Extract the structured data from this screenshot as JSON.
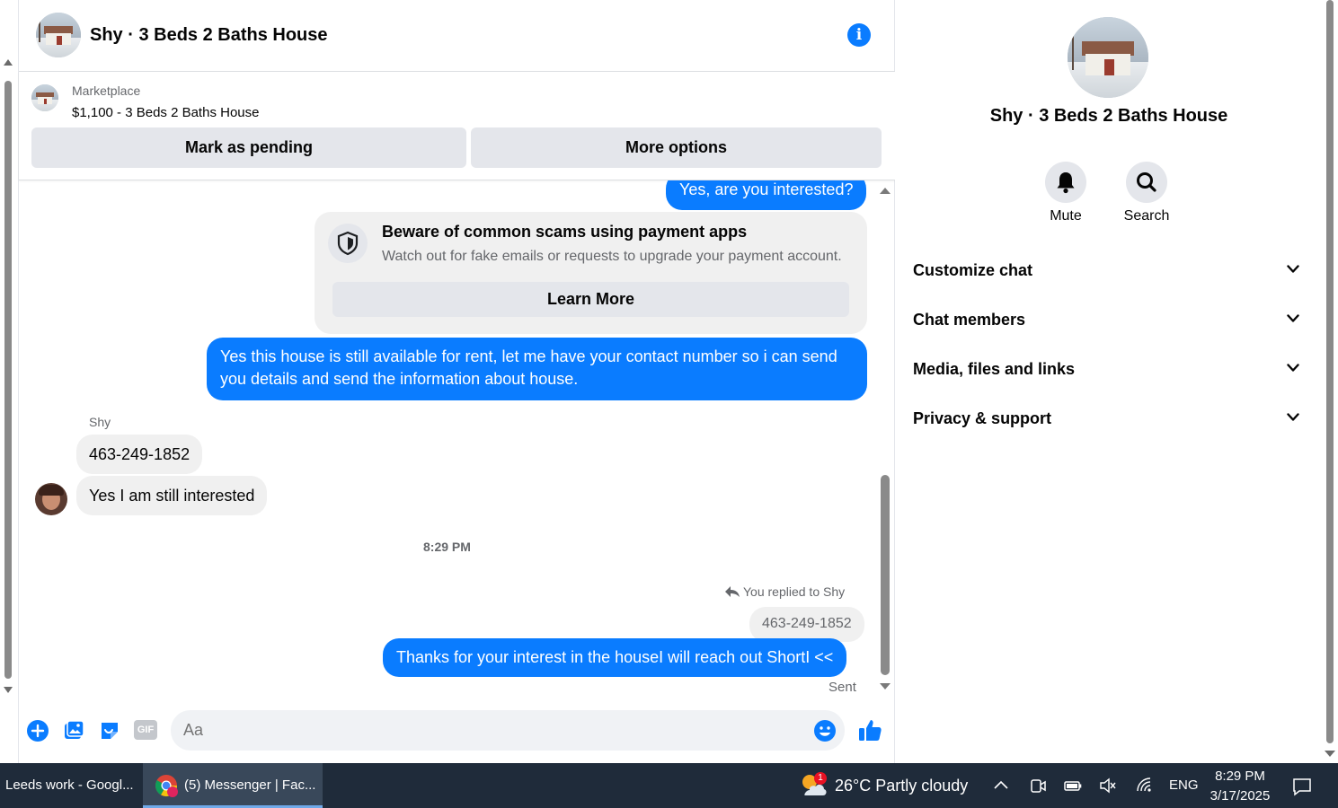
{
  "chat": {
    "title": "Shy · 3 Beds 2 Baths House",
    "marketplace_label": "Marketplace",
    "listing": "$1,100 - 3 Beds 2 Baths House",
    "mark_pending_label": "Mark as pending",
    "more_options_label": "More options"
  },
  "messages": {
    "out_1": "Yes, are you interested?",
    "scam_title": "Beware of common scams using payment apps",
    "scam_sub": "Watch out for fake emails or requests to upgrade your payment account.",
    "learn_more": "Learn More",
    "out_2": "Yes this house is still available for rent, let me have your contact number so i can send you details and send the information about house.",
    "sender_name": "Shy",
    "in_1": "463-249-1852",
    "in_2": "Yes I am still interested",
    "timestamp": "8:29 PM",
    "replied_label": "You replied to Shy",
    "quoted": "463-249-1852",
    "out_3": "Thanks for your interest in the houseI will reach out ShortI <<",
    "sent_status": "Sent"
  },
  "composer": {
    "placeholder": "Aa",
    "gif_label": "GIF"
  },
  "details": {
    "title": "Shy · 3 Beds 2 Baths House",
    "mute_label": "Mute",
    "search_label": "Search",
    "sections": [
      "Customize chat",
      "Chat members",
      "Media, files and links",
      "Privacy & support"
    ]
  },
  "taskbar": {
    "item_1": "Leeds work - Googl...",
    "item_2": "(5) Messenger | Fac...",
    "weather": "26°C  Partly cloudy",
    "weather_badge": "1",
    "lang": "ENG",
    "time": "8:29 PM",
    "date": "3/17/2025"
  },
  "colors": {
    "accent": "#0a7cff",
    "bubble_in": "#f0f0f0",
    "taskbar": "#1f2b3a"
  }
}
